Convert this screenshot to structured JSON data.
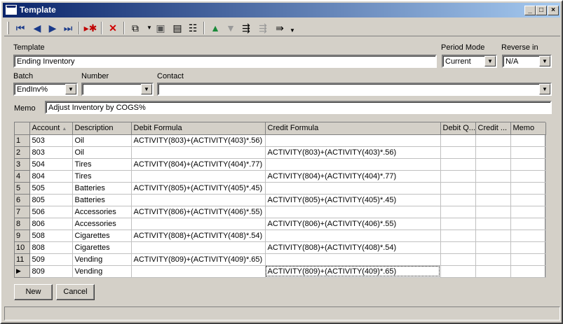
{
  "window": {
    "title": "Template"
  },
  "icons": {
    "first": "first-record-icon",
    "prev": "previous-record-icon",
    "next": "next-record-icon",
    "last": "last-record-icon",
    "new": "new-record-icon",
    "delete": "delete-icon",
    "find": "find-icon",
    "save": "save-icon",
    "save_close": "save-close-icon",
    "properties": "properties-icon",
    "up": "move-up-icon",
    "down": "move-down-icon",
    "insert": "insert-row-icon",
    "remove": "remove-row-icon",
    "more": "more-icon"
  },
  "form": {
    "template_label": "Template",
    "template_value": "Ending Inventory",
    "period_mode_label": "Period Mode",
    "period_mode_value": "Current",
    "reverse_in_label": "Reverse in",
    "reverse_in_value": "N/A",
    "batch_label": "Batch",
    "batch_value": "EndInv%",
    "number_label": "Number",
    "number_value": "",
    "contact_label": "Contact",
    "contact_value": "",
    "memo_label": "Memo",
    "memo_value": "Adjust Inventory by COGS%"
  },
  "grid": {
    "columns": [
      "Account",
      "Description",
      "Debit Formula",
      "Credit Formula",
      "Debit Q...",
      "Credit ...",
      "Memo"
    ],
    "sort_indicator": "▲",
    "current_row_marker": "▶",
    "rows": [
      {
        "n": "1",
        "account": "503",
        "desc": "Oil",
        "debit": "ACTIVITY(803)+(ACTIVITY(403)*.56)",
        "credit": ""
      },
      {
        "n": "2",
        "account": "803",
        "desc": "Oil",
        "debit": "",
        "credit": "ACTIVITY(803)+(ACTIVITY(403)*.56)"
      },
      {
        "n": "3",
        "account": "504",
        "desc": "Tires",
        "debit": "ACTIVITY(804)+(ACTIVITY(404)*.77)",
        "credit": ""
      },
      {
        "n": "4",
        "account": "804",
        "desc": "Tires",
        "debit": "",
        "credit": "ACTIVITY(804)+(ACTIVITY(404)*.77)"
      },
      {
        "n": "5",
        "account": "505",
        "desc": "Batteries",
        "debit": "ACTIVITY(805)+(ACTIVITY(405)*.45)",
        "credit": ""
      },
      {
        "n": "6",
        "account": "805",
        "desc": "Batteries",
        "debit": "",
        "credit": "ACTIVITY(805)+(ACTIVITY(405)*.45)"
      },
      {
        "n": "7",
        "account": "506",
        "desc": "Accessories",
        "debit": "ACTIVITY(806)+(ACTIVITY(406)*.55)",
        "credit": ""
      },
      {
        "n": "8",
        "account": "806",
        "desc": "Accessories",
        "debit": "",
        "credit": "ACTIVITY(806)+(ACTIVITY(406)*.55)"
      },
      {
        "n": "9",
        "account": "508",
        "desc": "Cigarettes",
        "debit": "ACTIVITY(808)+(ACTIVITY(408)*.54)",
        "credit": ""
      },
      {
        "n": "10",
        "account": "808",
        "desc": "Cigarettes",
        "debit": "",
        "credit": "ACTIVITY(808)+(ACTIVITY(408)*.54)"
      },
      {
        "n": "11",
        "account": "509",
        "desc": "Vending",
        "debit": "ACTIVITY(809)+(ACTIVITY(409)*.65)",
        "credit": ""
      },
      {
        "n": "",
        "account": "809",
        "desc": "Vending",
        "debit": "",
        "credit": "ACTIVITY(809)+(ACTIVITY(409)*.65)",
        "current": true
      }
    ]
  },
  "buttons": {
    "new": "New",
    "cancel": "Cancel"
  }
}
